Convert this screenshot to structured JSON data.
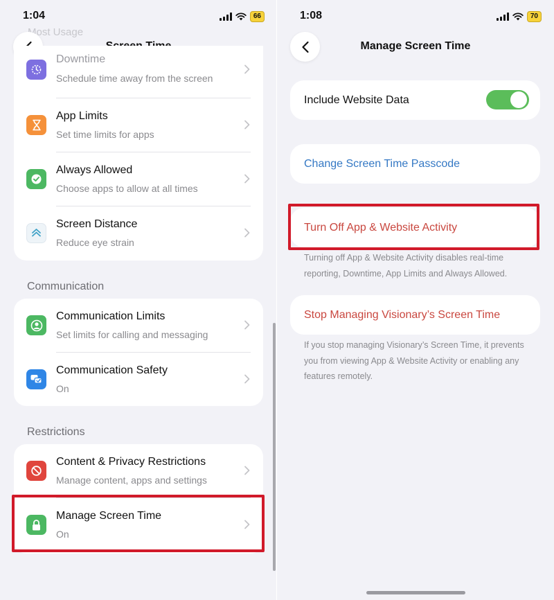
{
  "left_screen": {
    "status_bar": {
      "time": "1:04",
      "battery": "66"
    },
    "nav": {
      "title": "Screen Time"
    },
    "faded_header": "Most Usage",
    "limits_group": {
      "items": [
        {
          "title": "Downtime",
          "subtitle": "Schedule time away from the screen",
          "icon": "downtime-icon"
        },
        {
          "title": "App Limits",
          "subtitle": "Set time limits for apps",
          "icon": "hourglass-icon"
        },
        {
          "title": "Always Allowed",
          "subtitle": "Choose apps to allow at all times",
          "icon": "checkmark-seal-icon"
        },
        {
          "title": "Screen Distance",
          "subtitle": "Reduce eye strain",
          "icon": "screen-distance-icon"
        }
      ]
    },
    "communication_group": {
      "header": "Communication",
      "items": [
        {
          "title": "Communication Limits",
          "subtitle": "Set limits for calling and messaging",
          "icon": "person-circle-icon"
        },
        {
          "title": "Communication Safety",
          "subtitle": "On",
          "icon": "chat-bubbles-icon"
        }
      ]
    },
    "restrictions_group": {
      "header": "Restrictions",
      "items": [
        {
          "title": "Content & Privacy Restrictions",
          "subtitle": "Manage content, apps and settings",
          "icon": "no-sign-icon"
        },
        {
          "title": "Manage Screen Time",
          "subtitle": "On",
          "icon": "lock-icon"
        }
      ]
    }
  },
  "right_screen": {
    "status_bar": {
      "time": "1:08",
      "battery": "70"
    },
    "nav": {
      "title": "Manage Screen Time"
    },
    "website_data": {
      "label": "Include Website Data",
      "toggle_on": true
    },
    "change_passcode": {
      "label": "Change Screen Time Passcode"
    },
    "turn_off": {
      "label": "Turn Off App & Website Activity",
      "footnote": "Turning off App & Website Activity disables real-time reporting, Downtime, App Limits and Always Allowed."
    },
    "stop_managing": {
      "label": "Stop Managing Visionary’s Screen Time",
      "footnote": "If you stop managing Visionary’s Screen Time, it prevents you from viewing App & Website Activity or enabling any features remotely."
    }
  },
  "colors": {
    "background": "#f2f2f7",
    "link_blue": "#3478c4",
    "destructive_red": "#c9473f",
    "highlight_red": "#d11a2a",
    "toggle_green": "#5bbd5a"
  }
}
